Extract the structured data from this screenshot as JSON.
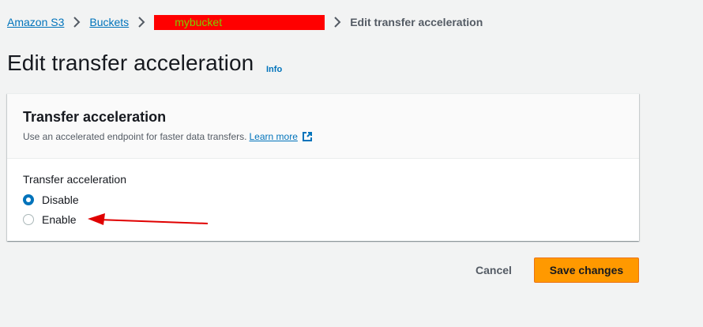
{
  "breadcrumb": {
    "items": [
      "Amazon S3",
      "Buckets"
    ],
    "bucket": "mybucket",
    "current": "Edit transfer acceleration"
  },
  "page": {
    "title": "Edit transfer acceleration",
    "info": "Info"
  },
  "panel": {
    "title": "Transfer acceleration",
    "description": "Use an accelerated endpoint for faster data transfers.",
    "learn_more": "Learn more",
    "field_label": "Transfer acceleration",
    "options": [
      {
        "label": "Disable",
        "selected": true
      },
      {
        "label": "Enable",
        "selected": false
      }
    ]
  },
  "actions": {
    "cancel": "Cancel",
    "save": "Save changes"
  },
  "colors": {
    "accent": "#0073bb",
    "primary_button": "#ff9900",
    "annotation_arrow": "#e00000",
    "redaction": "#ff0000"
  }
}
